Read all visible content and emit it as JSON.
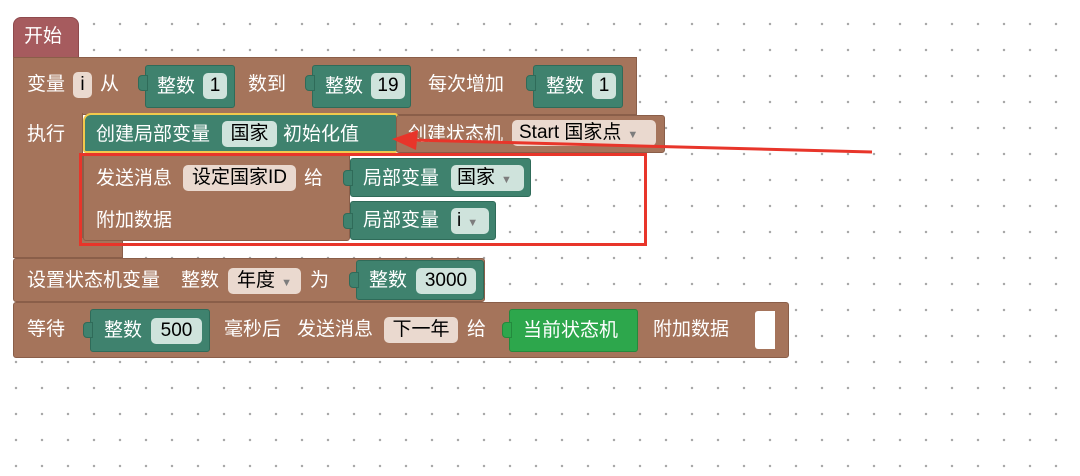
{
  "start": {
    "label": "开始"
  },
  "loop": {
    "var_label": "变量",
    "var_name": "i",
    "from_label": "从",
    "int_label": "整数",
    "from_value": "1",
    "to_label": "数到",
    "to_value": "19",
    "step_label": "每次增加",
    "step_value": "1",
    "do_label": "执行"
  },
  "create_local": {
    "label": "创建局部变量",
    "var_name": "国家",
    "init_label": "初始化值",
    "create_sm_label": "创建状态机",
    "sm_value": "Start 国家点"
  },
  "send1": {
    "label": "发送消息",
    "message": "设定国家ID",
    "to_label": "给",
    "attach_label": "附加数据",
    "local_var_label": "局部变量",
    "local_var_value": "国家",
    "local_var2_label": "局部变量",
    "local_var2_value": "i"
  },
  "set_sm_var": {
    "label": "设置状态机变量",
    "type_label": "整数",
    "var_name": "年度",
    "as_label": "为",
    "int_label": "整数",
    "value": "3000"
  },
  "wait": {
    "label": "等待",
    "int_label": "整数",
    "value": "500",
    "ms_label": "毫秒后",
    "send_label": "发送消息",
    "message": "下一年",
    "to_label": "给",
    "target": "当前状态机",
    "attach_label": "附加数据"
  },
  "colors": {
    "control": "#a5745b",
    "hat": "#a65b5e",
    "value_block": "#3f826e",
    "current_sm": "#2da74c",
    "highlight_yellow": "#f2c94c",
    "annotation_red": "#e8352a"
  }
}
